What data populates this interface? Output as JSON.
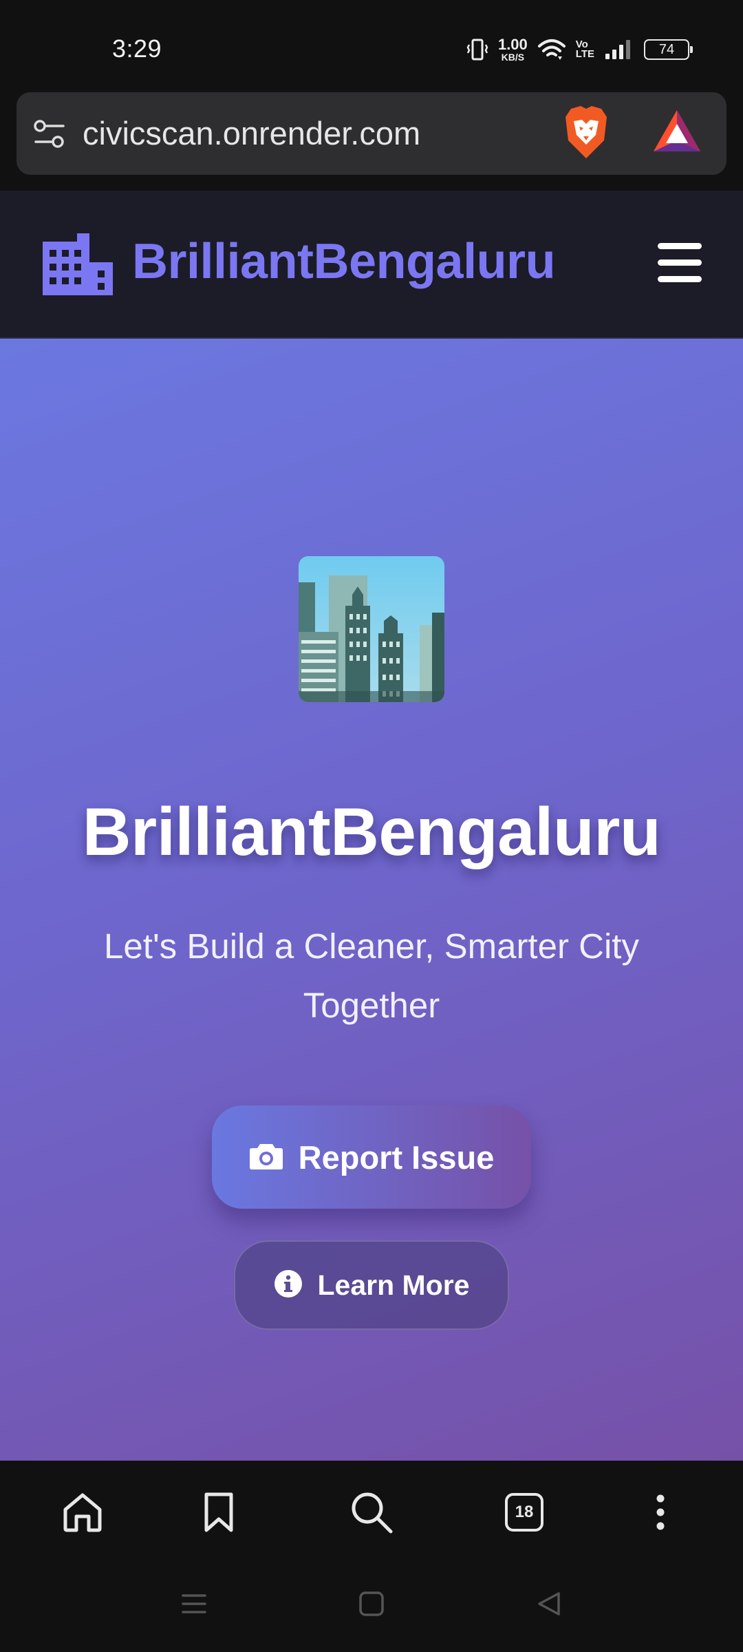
{
  "status_bar": {
    "time": "3:29",
    "net_speed_value": "1.00",
    "net_speed_unit": "KB/S",
    "volte_top": "Vo",
    "volte_bottom": "LTE",
    "battery": "74"
  },
  "browser": {
    "url": "civicscan.onrender.com",
    "tab_count": "18"
  },
  "site_nav": {
    "brand": "BrilliantBengaluru"
  },
  "hero": {
    "title": "BrilliantBengaluru",
    "subtitle": "Let's Build a Cleaner, Smarter City Together",
    "report_button": "Report Issue",
    "learn_button": "Learn More"
  },
  "colors": {
    "brand": "#7b77f2",
    "hero_gradient_start": "#6b78e0",
    "hero_gradient_end": "#7651a8",
    "navbar_bg": "#1b1c27"
  },
  "icons": {
    "address_bar": [
      "tune-icon",
      "brave-lion-icon",
      "bat-triangle-icon"
    ],
    "site_nav": [
      "city-buildings-icon",
      "hamburger-menu-icon"
    ],
    "hero": [
      "cityscape-emoji",
      "camera-icon",
      "info-circle-icon"
    ],
    "toolbar": [
      "home-icon",
      "bookmark-icon",
      "search-icon",
      "tabs-icon",
      "more-vertical-icon"
    ],
    "system_nav": [
      "recents-icon",
      "home-square-icon",
      "back-triangle-icon"
    ]
  }
}
